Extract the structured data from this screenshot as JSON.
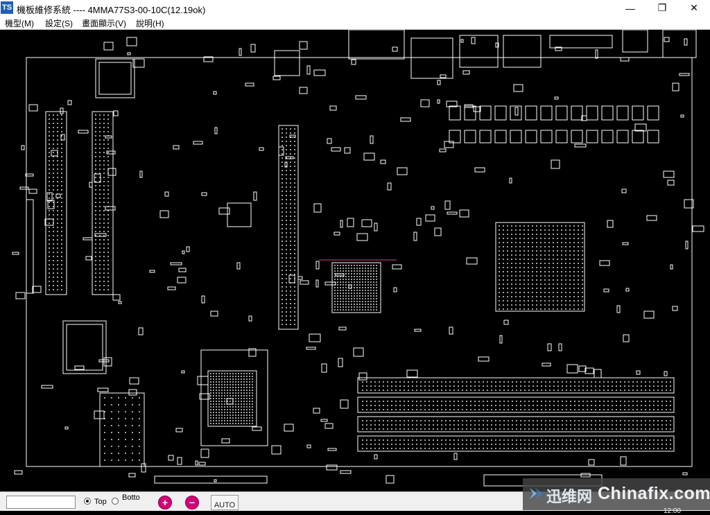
{
  "window": {
    "title": "機板維修系統 ---- 4MMA77S3-00-10C(12.19ok)",
    "icon_text": "TS",
    "controls": {
      "minimize": "—",
      "maximize": "❐",
      "close": "✕"
    }
  },
  "menu": {
    "items": [
      {
        "label": "機型(M)"
      },
      {
        "label": "設定(S)"
      },
      {
        "label": "畫面顯示(V)"
      },
      {
        "label": "說明(H)"
      }
    ]
  },
  "toolbar": {
    "search_value": "",
    "side_top_label": "Top",
    "side_bottom_label": "Botto",
    "selected_side": "top",
    "zoom_in_label": "+",
    "zoom_out_label": "−",
    "auto_label": "AUTO"
  },
  "board": {
    "background": "#000000",
    "outline_color": "#ffffff",
    "crosshair_color": "#c0288a"
  },
  "watermark": {
    "cn_text": "迅维网",
    "en_text": "Chinafix.com"
  },
  "taskbar": {
    "clock": "12:00"
  }
}
